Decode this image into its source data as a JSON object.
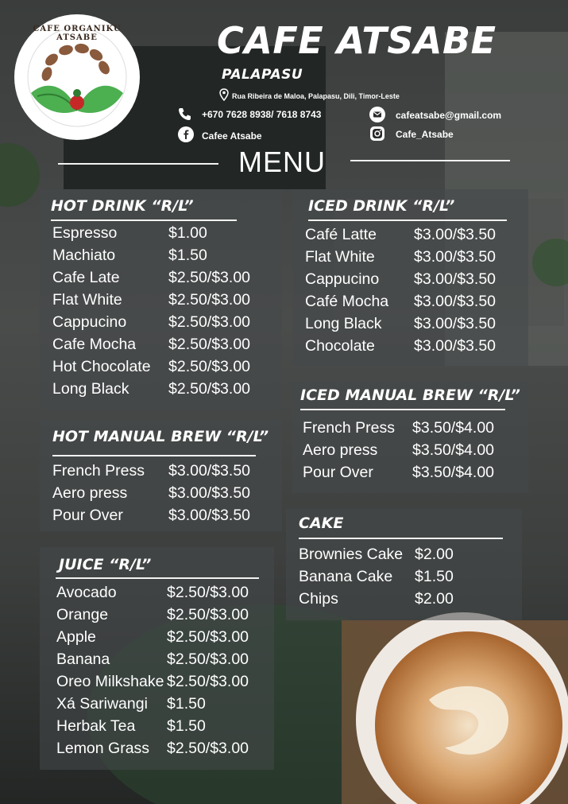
{
  "brand": {
    "title": "CAFE ATSABE",
    "subtitle": "PALAPASU",
    "address": "Rua Ribeira de Maloa, Palapasu, Dili, Timor-Leste",
    "phone": "+670 7628 8938/ 7618 8743",
    "email": "cafeatsabe@gmail.com",
    "facebook": "Cafee Atsabe",
    "instagram": "Cafe_Atsabe",
    "logo_text": "CAFE ORGANIKU ATSABE"
  },
  "menu_heading": "MENU",
  "sections": {
    "hot_drink": {
      "title": "HOT DRINK “R/L”",
      "items": [
        {
          "name": "Espresso",
          "price": "$1.00"
        },
        {
          "name": "Machiato",
          "price": "$1.50"
        },
        {
          "name": "Cafe Late",
          "price": "$2.50/$3.00"
        },
        {
          "name": "Flat White",
          "price": "$2.50/$3.00"
        },
        {
          "name": "Cappucino",
          "price": "$2.50/$3.00"
        },
        {
          "name": "Cafe Mocha",
          "price": "$2.50/$3.00"
        },
        {
          "name": "Hot Chocolate",
          "price": "$2.50/$3.00"
        },
        {
          "name": "Long Black",
          "price": "$2.50/$3.00"
        }
      ]
    },
    "iced_drink": {
      "title": "ICED DRINK “R/L”",
      "items": [
        {
          "name": "Café Latte",
          "price": "$3.00/$3.50"
        },
        {
          "name": "Flat White",
          "price": "$3.00/$3.50"
        },
        {
          "name": "Cappucino",
          "price": "$3.00/$3.50"
        },
        {
          "name": "Café Mocha",
          "price": "$3.00/$3.50"
        },
        {
          "name": "Long Black",
          "price": "$3.00/$3.50"
        },
        {
          "name": "Chocolate",
          "price": "$3.00/$3.50"
        }
      ]
    },
    "hot_manual_brew": {
      "title": "HOT MANUAL BREW “R/L”",
      "items": [
        {
          "name": "French Press",
          "price": "$3.00/$3.50"
        },
        {
          "name": "Aero press",
          "price": "$3.00/$3.50"
        },
        {
          "name": "Pour Over",
          "price": "$3.00/$3.50"
        }
      ]
    },
    "iced_manual_brew": {
      "title": "ICED MANUAL BREW “R/L”",
      "items": [
        {
          "name": "French Press",
          "price": "$3.50/$4.00"
        },
        {
          "name": "Aero press",
          "price": "$3.50/$4.00"
        },
        {
          "name": "Pour Over",
          "price": "$3.50/$4.00"
        }
      ]
    },
    "juice": {
      "title": "JUICE “R/L”",
      "items": [
        {
          "name": "Avocado",
          "price": "$2.50/$3.00"
        },
        {
          "name": "Orange",
          "price": "$2.50/$3.00"
        },
        {
          "name": "Apple",
          "price": "$2.50/$3.00"
        },
        {
          "name": "Banana",
          "price": "$2.50/$3.00"
        },
        {
          "name": "Oreo Milkshake",
          "price": "$2.50/$3.00"
        },
        {
          "name": "Xá Sariwangi",
          "price": "$1.50"
        },
        {
          "name": "Herbak Tea",
          "price": "$1.50"
        },
        {
          "name": "Lemon Grass",
          "price": "$2.50/$3.00"
        }
      ]
    },
    "cake": {
      "title": "CAKE",
      "items": [
        {
          "name": "Brownies Cake",
          "price": "$2.00"
        },
        {
          "name": "Banana Cake",
          "price": "$1.50"
        },
        {
          "name": "Chips",
          "price": "$2.00"
        }
      ]
    }
  },
  "icons": [
    "location-pin-icon",
    "phone-icon",
    "email-icon",
    "facebook-icon",
    "instagram-icon"
  ],
  "colors": {
    "text": "#ffffff",
    "panel": "#46484a",
    "coffee_bean": "#8a5a3c",
    "leaf": "#4caf50",
    "logo_red": "#c62828"
  }
}
